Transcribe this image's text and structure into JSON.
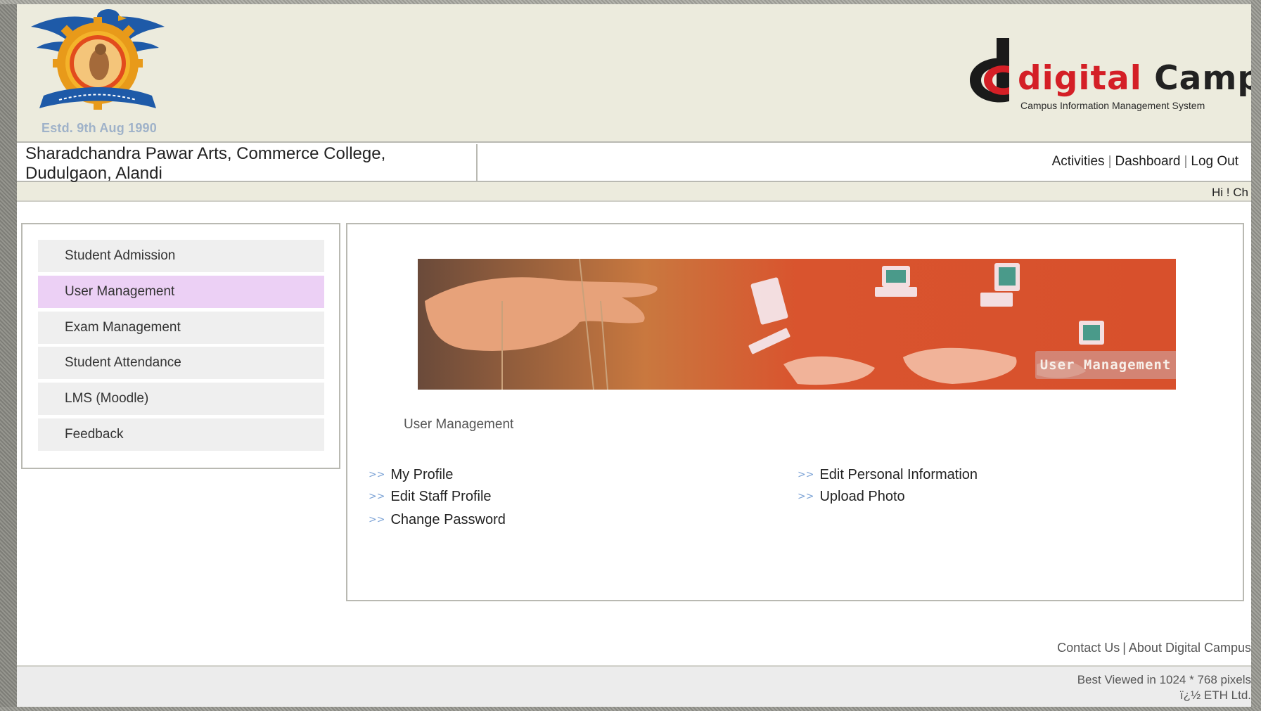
{
  "header": {
    "logo_established": "Estd. 9th Aug 1990",
    "brand_name_accent": "digital",
    "brand_name_rest": " Campus",
    "brand_subtitle": "Campus Information Management System",
    "college_name": "Sharadchandra Pawar Arts, Commerce College, Dudulgaon, Alandi",
    "nav": [
      {
        "label": "Activities"
      },
      {
        "label": "Dashboard"
      },
      {
        "label": "Log Out"
      }
    ],
    "nav_separator": "|",
    "greeting": "Hi ! Ch"
  },
  "sidebar": {
    "items": [
      {
        "label": "Student Admission",
        "active": false
      },
      {
        "label": "User Management",
        "active": true
      },
      {
        "label": "Exam Management",
        "active": false
      },
      {
        "label": "Student Attendance",
        "active": false
      },
      {
        "label": "LMS (Moodle)",
        "active": false
      },
      {
        "label": "Feedback",
        "active": false
      }
    ]
  },
  "main": {
    "banner_label": "User Management",
    "section_title": "User Management",
    "link_marker": ">>",
    "links_left": [
      {
        "label": "My Profile"
      },
      {
        "label": "Edit Staff Profile"
      },
      {
        "label": "Change Password"
      }
    ],
    "links_right": [
      {
        "label": "Edit Personal Information"
      },
      {
        "label": "Upload Photo"
      }
    ]
  },
  "footer": {
    "contact": "Contact Us",
    "separator": "|",
    "about": "About Digital Campus",
    "best_viewed": "Best Viewed in 1024 * 768 pixels",
    "copyright": "ï¿½ ETH Ltd."
  },
  "colors": {
    "header_bg": "#ecebdd",
    "active_menu_bg": "#ecd0f5",
    "menu_bg": "#efefef",
    "brand_red": "#d41f26",
    "link_arrow": "#7ea4d6"
  }
}
